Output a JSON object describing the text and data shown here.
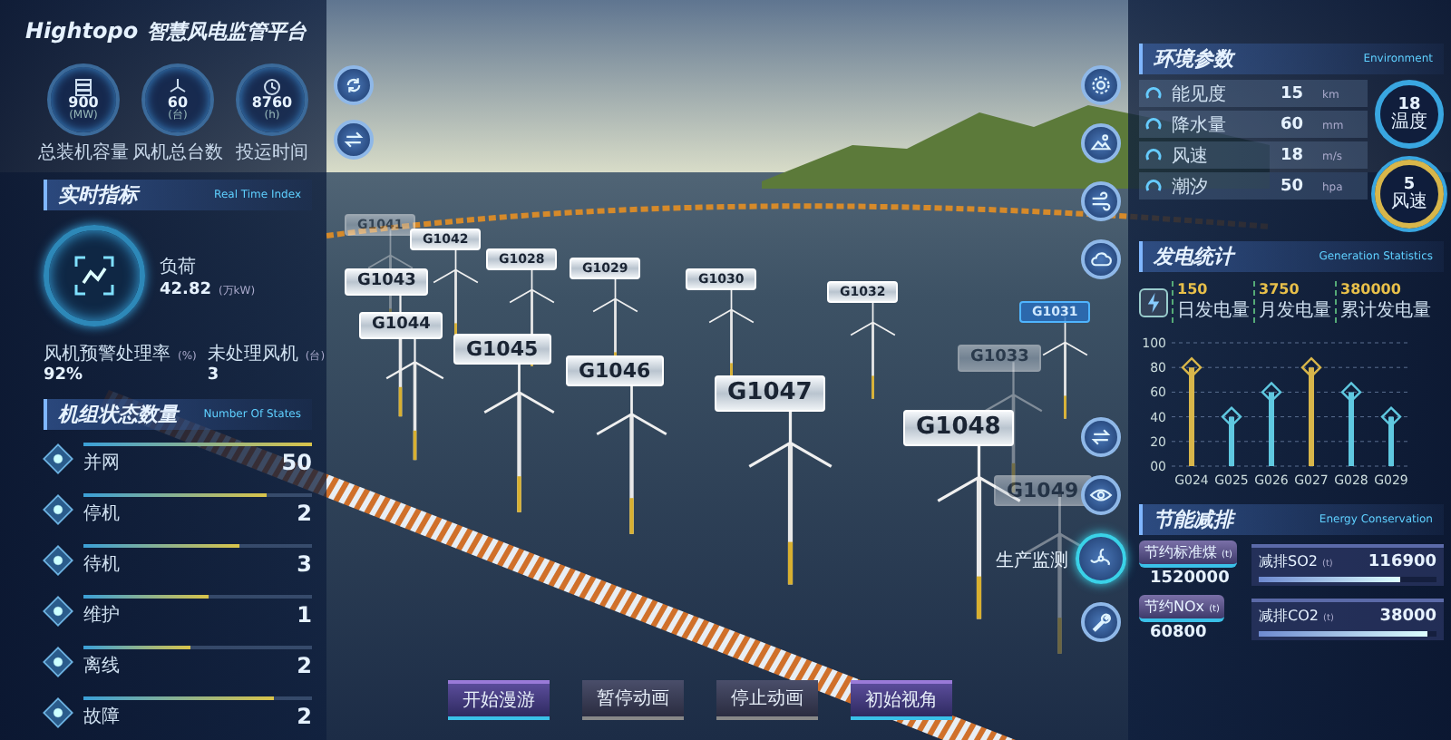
{
  "title": {
    "brand": "Hightopo",
    "name": "智慧风电监管平台"
  },
  "kpis": [
    {
      "value": "900",
      "unit": "(MW)",
      "label": "总装机容量",
      "kind": "stack"
    },
    {
      "value": "60",
      "unit": "(台)",
      "label": "风机总台数",
      "kind": "fan"
    },
    {
      "value": "8760",
      "unit": "(h)",
      "label": "投运时间",
      "kind": "clock"
    }
  ],
  "realtime": {
    "title": "实时指标",
    "subtitle": "Real Time Index",
    "load": {
      "label": "负荷",
      "value": "42.82",
      "unit": "(万kW)"
    },
    "stats": [
      {
        "label": "风机预警处理率",
        "unit": "(%)",
        "value": "92%"
      },
      {
        "label": "未处理风机",
        "unit": "(台)",
        "value": "3"
      }
    ]
  },
  "states": {
    "title": "机组状态数量",
    "subtitle": "Number Of States",
    "items": [
      {
        "label": "并网",
        "value": "50",
        "level": 1.0
      },
      {
        "label": "停机",
        "value": "2",
        "level": 0.8
      },
      {
        "label": "待机",
        "value": "3",
        "level": 0.68
      },
      {
        "label": "维护",
        "value": "1",
        "level": 0.55
      },
      {
        "label": "离线",
        "value": "2",
        "level": 0.47
      },
      {
        "label": "故障",
        "value": "2",
        "level": 0.83
      }
    ]
  },
  "turbines": [
    {
      "label": "G1041",
      "faded": true
    },
    {
      "label": "G1042",
      "faded": false
    },
    {
      "label": "G1043",
      "faded": false
    },
    {
      "label": "G1044",
      "faded": false
    },
    {
      "label": "G1045",
      "faded": false
    },
    {
      "label": "G1046",
      "faded": false
    },
    {
      "label": "G1047",
      "faded": false
    },
    {
      "label": "G1048",
      "faded": false
    },
    {
      "label": "G1028",
      "faded": false
    },
    {
      "label": "G1029",
      "faded": false
    },
    {
      "label": "G1030",
      "faded": false
    },
    {
      "label": "G1032",
      "faded": false
    },
    {
      "label": "G1031",
      "faded": false,
      "selected": true
    },
    {
      "label": "G1033",
      "faded": true
    },
    {
      "label": "G1049",
      "faded": true
    }
  ],
  "tools_left": [
    {
      "kind": "refresh"
    },
    {
      "kind": "swap"
    }
  ],
  "tools_right": [
    {
      "kind": "gear",
      "selected": false
    },
    {
      "kind": "landscape",
      "selected": false
    },
    {
      "kind": "wind",
      "selected": false
    },
    {
      "kind": "cloud",
      "selected": false
    },
    {
      "kind": "swap",
      "selected": false
    },
    {
      "kind": "eye",
      "selected": false
    },
    {
      "kind": "fan",
      "selected": true,
      "label": "生产监测"
    },
    {
      "kind": "wrench",
      "selected": false
    }
  ],
  "controls": [
    {
      "label": "开始漫游",
      "kind": "primary"
    },
    {
      "label": "暂停动画",
      "kind": "secondary"
    },
    {
      "label": "停止动画",
      "kind": "secondary"
    },
    {
      "label": "初始视角",
      "kind": "primary"
    }
  ],
  "environment": {
    "title": "环境参数",
    "subtitle": "Environment",
    "rows": [
      {
        "label": "能见度",
        "value": "15",
        "unit": "km"
      },
      {
        "label": "降水量",
        "value": "60",
        "unit": "mm"
      },
      {
        "label": "风速",
        "value": "18",
        "unit": "m/s"
      },
      {
        "label": "潮汐",
        "value": "50",
        "unit": "hpa"
      }
    ],
    "gauges": [
      {
        "value": "18",
        "label": "温度",
        "kind": "cyan"
      },
      {
        "value": "5",
        "label": "风速",
        "kind": "gold"
      }
    ]
  },
  "generation": {
    "title": "发电统计",
    "subtitle": "Generation Statistics",
    "stats": [
      {
        "value": "150",
        "label": "日发电量"
      },
      {
        "value": "3750",
        "label": "月发电量"
      },
      {
        "value": "380000",
        "label": "累计发电量"
      }
    ],
    "chart_data": {
      "type": "bar",
      "categories": [
        "G024",
        "G025",
        "G026",
        "G027",
        "G028",
        "G029"
      ],
      "series": [
        {
          "color": "#d8b64a",
          "values": [
            80,
            null,
            null,
            80,
            null,
            null
          ]
        },
        {
          "color": "#5fc8e0",
          "values": [
            null,
            40,
            60,
            null,
            60,
            40
          ]
        }
      ],
      "grid": true,
      "ylim": [
        0,
        100
      ],
      "yticks": [
        {
          "value": 0,
          "label": "00"
        },
        20,
        40,
        60,
        80,
        100
      ]
    }
  },
  "conservation": {
    "title": "节能减排",
    "subtitle": "Energy Conservation",
    "savings": [
      {
        "label": "节约标准煤",
        "unit": "(t)",
        "value": "1520000"
      },
      {
        "label": "节约NOx",
        "unit": "(t)",
        "value": "60800"
      }
    ],
    "reductions": [
      {
        "label": "减排SO2",
        "unit": "(t)",
        "value": "116900",
        "level": 0.8
      },
      {
        "label": "减排CO2",
        "unit": "(t)",
        "value": "38000",
        "level": 0.95
      }
    ]
  }
}
